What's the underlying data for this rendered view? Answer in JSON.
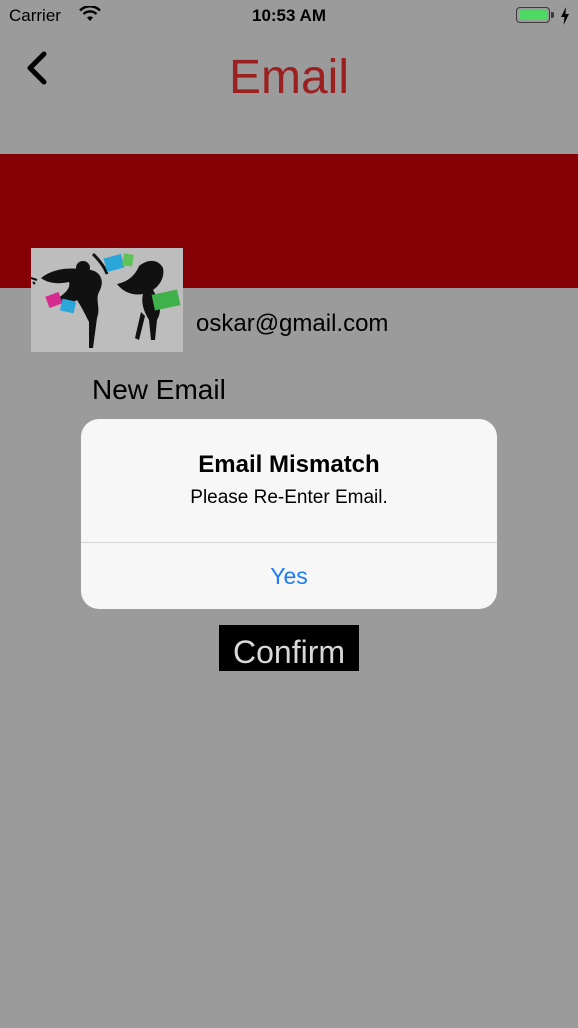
{
  "status_bar": {
    "carrier": "Carrier",
    "time": "10:53 AM",
    "battery_color": "#4cd964",
    "charging_icon": "bolt-icon"
  },
  "nav": {
    "title": "Email",
    "title_color": "#9b2121",
    "back_icon": "chevron-left-icon"
  },
  "banner": {
    "color": "#840005"
  },
  "profile": {
    "email": "oskar@gmail.com"
  },
  "form": {
    "new_email_label": "New Email",
    "confirm_label": "Confirm"
  },
  "alert": {
    "title": "Email Mismatch",
    "message": "Please Re-Enter Email.",
    "button_label": "Yes",
    "button_color": "#1b7cf3"
  }
}
